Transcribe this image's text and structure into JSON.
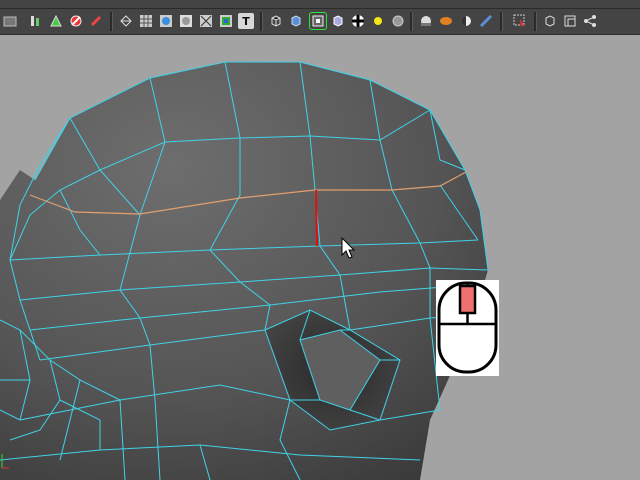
{
  "toolbar": {
    "text_tool_glyph": "T",
    "buttons": [
      {
        "name": "paint-effects-icon"
      },
      {
        "name": "uv-editor-icon"
      },
      {
        "name": "vertex-color-icon"
      },
      {
        "name": "paint-weights-icon"
      },
      {
        "name": "wireframe-mode-icon"
      },
      {
        "name": "grid-toggle-icon"
      },
      {
        "name": "shaded-sphere-icon"
      },
      {
        "name": "smooth-shade-icon"
      },
      {
        "name": "xray-icon"
      },
      {
        "name": "texture-icon"
      },
      {
        "name": "text-tool-icon"
      },
      {
        "name": "cube-wire-icon"
      },
      {
        "name": "cube-shaded-icon"
      },
      {
        "name": "select-mode-icon"
      },
      {
        "name": "cube-lit-icon"
      },
      {
        "name": "checker-icon"
      },
      {
        "name": "light-bulb-icon"
      },
      {
        "name": "gray-sphere-icon"
      },
      {
        "name": "camera-icon"
      },
      {
        "name": "orange-object-icon"
      },
      {
        "name": "half-sphere-icon"
      },
      {
        "name": "render-icon"
      },
      {
        "name": "isolate-select-icon"
      },
      {
        "name": "panel-layout-icon"
      },
      {
        "name": "two-panel-icon"
      },
      {
        "name": "share-icon"
      }
    ]
  },
  "mouse_indicator": {
    "button": "middle",
    "button_color": "#f07070"
  },
  "colors": {
    "wire": "#3fd3e8",
    "edge_loop": "#e0a070",
    "selected_edge": "#e01010",
    "mesh_face": "#555555",
    "background": "#a3a3a3"
  }
}
